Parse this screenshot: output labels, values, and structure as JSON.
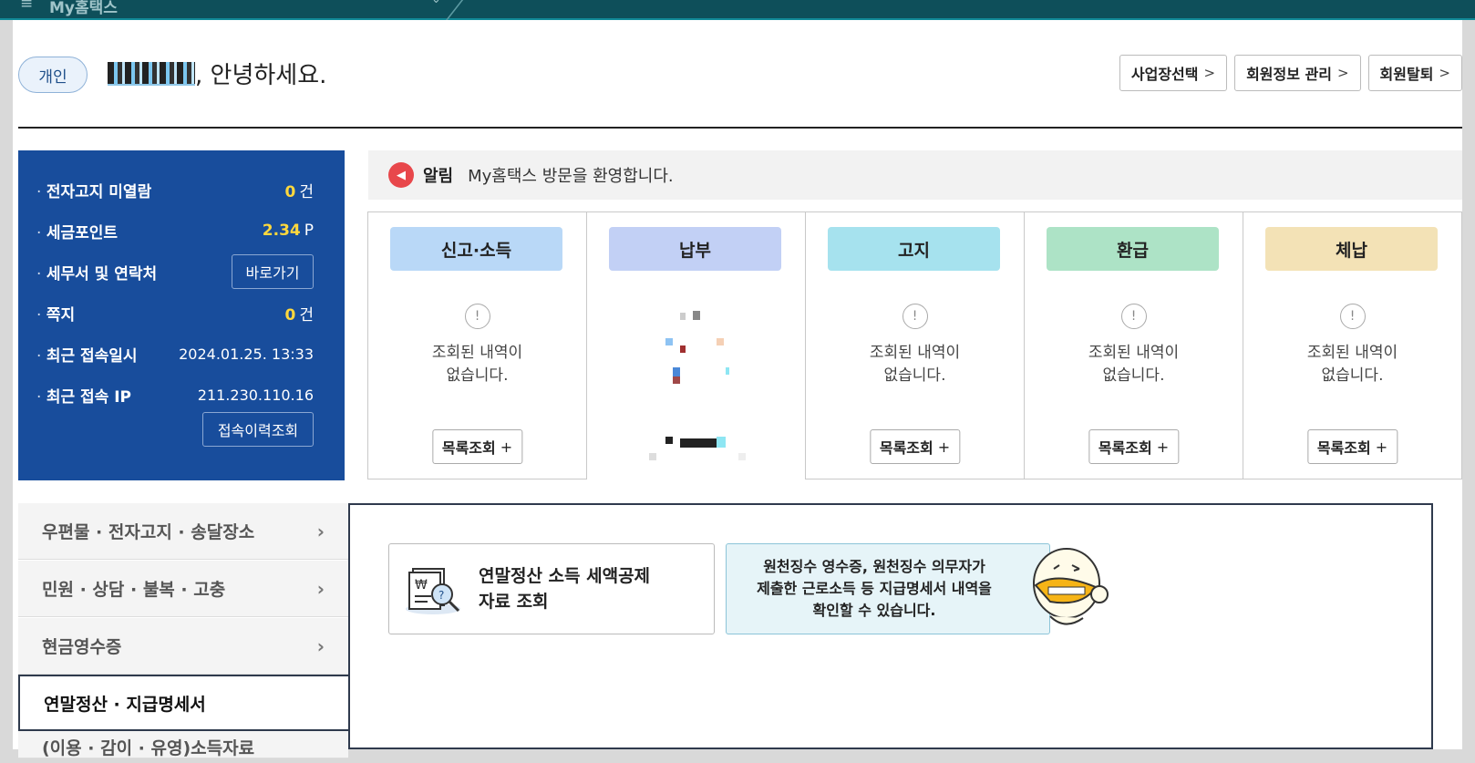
{
  "topbar": {
    "menu_icon": "≡",
    "title": "My홈택스",
    "caret": "⌄"
  },
  "header": {
    "user_type": "개인",
    "greeting": ", 안녕하세요.",
    "buttons": [
      {
        "label": "사업장선택",
        "chevron": ">"
      },
      {
        "label": "회원정보 관리",
        "chevron": ">"
      },
      {
        "label": "회원탈퇴",
        "chevron": ">"
      }
    ]
  },
  "info": {
    "unread_notice": {
      "label": "전자고지 미열람",
      "value": "0",
      "unit": "건"
    },
    "tax_points": {
      "label": "세금포인트",
      "value": "2.34",
      "unit": "P"
    },
    "tax_office": {
      "label": "세무서 및 연락처",
      "button": "바로가기"
    },
    "messages": {
      "label": "쪽지",
      "value": "0",
      "unit": "건"
    },
    "last_login": {
      "label": "최근 접속일시",
      "value": "2024.01.25.  13:33"
    },
    "last_ip": {
      "label": "최근 접속 IP",
      "value": "211.230.110.16",
      "button": "접속이력조회"
    }
  },
  "notice": {
    "label": "알림",
    "text": "My홈택스 방문을 환영합니다."
  },
  "cards": [
    {
      "title": "신고·소득",
      "color": "#b9d8f7",
      "empty": "조회된 내역이\n없습니다.",
      "button": "목록조회",
      "plus": "+"
    },
    {
      "title": "납부",
      "color": "#c2d0f5",
      "button": "목록조회",
      "plus": "+"
    },
    {
      "title": "고지",
      "color": "#a6e2ee",
      "empty": "조회된 내역이\n없습니다.",
      "button": "목록조회",
      "plus": "+"
    },
    {
      "title": "환급",
      "color": "#ade3c6",
      "empty": "조회된 내역이\n없습니다.",
      "button": "목록조회",
      "plus": "+"
    },
    {
      "title": "체납",
      "color": "#f3e2b6",
      "empty": "조회된 내역이\n없습니다.",
      "button": "목록조회",
      "plus": "+"
    }
  ],
  "side_menu": [
    {
      "label": "우편물 · 전자고지 · 송달장소",
      "arrow": "›"
    },
    {
      "label": "민원 · 상담 · 불복 · 고충",
      "arrow": "›"
    },
    {
      "label": "현금영수증",
      "arrow": "›"
    },
    {
      "label": "연말정산 · 지급명세서",
      "active": true
    },
    {
      "label": "(이용 · 감이 · 유영)소득자료"
    }
  ],
  "panel": {
    "lookup_title": "연말정산 소득 세액공제\n자료 조회",
    "description": "원천징수 영수증, 원천징수 의무자가\n제출한 근로소득 등 지급명세서 내역을\n확인할 수 있습니다."
  }
}
